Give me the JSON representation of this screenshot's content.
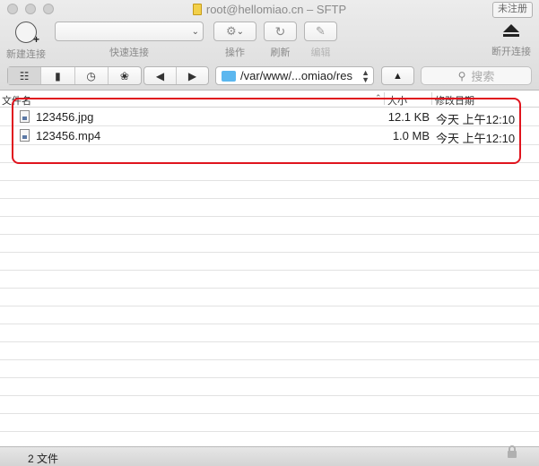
{
  "window": {
    "title": "root@hellomiao.cn – SFTP",
    "unregistered_label": "未注册"
  },
  "toolbar": {
    "new_connection": "新建连接",
    "quick_connect": "快速连接",
    "quick_connect_value": "",
    "actions": "操作",
    "refresh": "刷新",
    "edit": "编辑",
    "disconnect": "断开连接"
  },
  "nav": {
    "path": "/var/www/...omiao/res",
    "search_placeholder": "搜索"
  },
  "columns": {
    "name": "文件名",
    "size": "大小",
    "modified": "修改日期"
  },
  "files": [
    {
      "name": "123456.jpg",
      "size": "12.1 KB",
      "modified": "今天 上午12:10"
    },
    {
      "name": "123456.mp4",
      "size": "1.0 MB",
      "modified": "今天 上午12:10"
    }
  ],
  "status": {
    "count": "2 文件"
  },
  "colors": {
    "highlight": "#e0141e",
    "folder": "#5bb7ef"
  },
  "icons": [
    "new-connection-icon",
    "gear-icon",
    "refresh-icon",
    "pencil-icon",
    "eject-icon",
    "outline-view-icon",
    "bookmarks-icon",
    "history-icon",
    "bonjour-icon",
    "back-icon",
    "forward-icon",
    "folder-icon",
    "up-icon",
    "search-icon",
    "file-icon",
    "lock-icon"
  ]
}
